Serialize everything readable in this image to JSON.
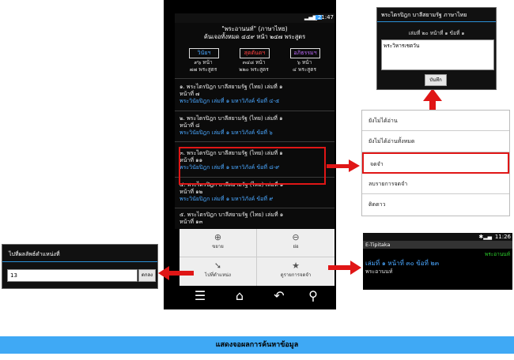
{
  "phone": {
    "status_time": "21:47",
    "header": {
      "title_line1": "\"พระอานนท์\" (ภาษาไทย)",
      "title_line2": "ค้นเจอทั้งหมด ๔๔๙ หน้า ๒๔๗ พระสูตร"
    },
    "tabs": [
      {
        "label": "วินัยฯ",
        "color": "#4aa7ff",
        "line1": "๙๖ หน้า",
        "line2": "๗๗ พระสูตร"
      },
      {
        "label": "สุตตันตฯ",
        "color": "#ff4040",
        "line1": "๓๔๘ หน้า",
        "line2": "๒๒๐ พระสูตร"
      },
      {
        "label": "อภิธรรมฯ",
        "color": "#c06cff",
        "line1": "๖ หน้า",
        "line2": "๔ พระสูตร"
      }
    ],
    "results": [
      {
        "line1": "๑. พระไตรปิฎก บาลีสยามรัฐ (ไทย) เล่มที่ ๑",
        "line2": "หน้าที่ ๗",
        "line3": "พระวินัยปิฎก เล่มที่ ๑ มหาวิภังค์ ข้อที่ ๔-๕"
      },
      {
        "line1": "๒. พระไตรปิฎก บาลีสยามรัฐ (ไทย) เล่มที่ ๑",
        "line2": "หน้าที่ ๘",
        "line3": "พระวินัยปิฎก เล่มที่ ๑ มหาวิภังค์ ข้อที่ ๖"
      },
      {
        "line1": "๓. พระไตรปิฎก บาลีสยามรัฐ (ไทย) เล่มที่ ๑",
        "line2": "หน้าที่ ๑๑",
        "line3": "พระวินัยปิฎก เล่มที่ ๑ มหาวิภังค์ ข้อที่ ๘-๙"
      },
      {
        "line1": "๔. พระไตรปิฎก บาลีสยามรัฐ (ไทย) เล่มที่ ๑",
        "line2": "หน้าที่ ๑๒",
        "line3": "พระวินัยปิฎก เล่มที่ ๑ มหาวิภังค์ ข้อที่ ๙"
      },
      {
        "line1": "๕. พระไตรปิฎก บาลีสยามรัฐ (ไทย) เล่มที่ ๑",
        "line2": "หน้าที่ ๑๓",
        "line3": ""
      }
    ],
    "menu": {
      "zoom_in": "ขยาย",
      "zoom_out": "ย่อ",
      "goto": "ไปที่ตำแหน่ง",
      "bookmarks": "ดูรายการจดจำ"
    }
  },
  "goto_dialog": {
    "title": "ไปที่ผลลัพธ์ตำแหน่งที่",
    "value": "13",
    "ok": "ตกลง"
  },
  "note_dialog": {
    "title": "พระไตรปิฎก บาลีสยามรัฐ ภาษาไทย",
    "subtitle": "เล่มที่ ๒๐ หน้าที่ ๑ ข้อที่ ๑",
    "text": "พระวิหารเชตวัน",
    "save": "บันทึก"
  },
  "context_menu": {
    "items": [
      "ยังไม่ได้อ่าน",
      "ยังไม่ได้อ่านทั้งหมด",
      "จดจำ",
      "ลบรายการจดจำ",
      "ติดดาว"
    ]
  },
  "mini_phone": {
    "time": "11:26",
    "app": "E-Tipitaka",
    "keyword": "พระอานนท์",
    "line1": "เล่มที่ ๑ หน้าที่ ๓๐ ข้อที่ ๒๓",
    "line2": "พระอานนท์"
  },
  "caption": "แสดงจอผลการค้นหาข้อมูล"
}
